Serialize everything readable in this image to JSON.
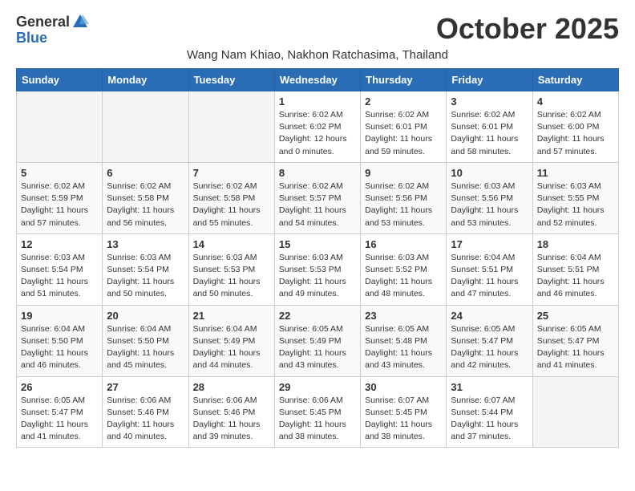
{
  "logo": {
    "general": "General",
    "blue": "Blue"
  },
  "title": "October 2025",
  "subtitle": "Wang Nam Khiao, Nakhon Ratchasima, Thailand",
  "weekdays": [
    "Sunday",
    "Monday",
    "Tuesday",
    "Wednesday",
    "Thursday",
    "Friday",
    "Saturday"
  ],
  "weeks": [
    [
      {
        "day": "",
        "info": ""
      },
      {
        "day": "",
        "info": ""
      },
      {
        "day": "",
        "info": ""
      },
      {
        "day": "1",
        "info": "Sunrise: 6:02 AM\nSunset: 6:02 PM\nDaylight: 12 hours\nand 0 minutes."
      },
      {
        "day": "2",
        "info": "Sunrise: 6:02 AM\nSunset: 6:01 PM\nDaylight: 11 hours\nand 59 minutes."
      },
      {
        "day": "3",
        "info": "Sunrise: 6:02 AM\nSunset: 6:01 PM\nDaylight: 11 hours\nand 58 minutes."
      },
      {
        "day": "4",
        "info": "Sunrise: 6:02 AM\nSunset: 6:00 PM\nDaylight: 11 hours\nand 57 minutes."
      }
    ],
    [
      {
        "day": "5",
        "info": "Sunrise: 6:02 AM\nSunset: 5:59 PM\nDaylight: 11 hours\nand 57 minutes."
      },
      {
        "day": "6",
        "info": "Sunrise: 6:02 AM\nSunset: 5:58 PM\nDaylight: 11 hours\nand 56 minutes."
      },
      {
        "day": "7",
        "info": "Sunrise: 6:02 AM\nSunset: 5:58 PM\nDaylight: 11 hours\nand 55 minutes."
      },
      {
        "day": "8",
        "info": "Sunrise: 6:02 AM\nSunset: 5:57 PM\nDaylight: 11 hours\nand 54 minutes."
      },
      {
        "day": "9",
        "info": "Sunrise: 6:02 AM\nSunset: 5:56 PM\nDaylight: 11 hours\nand 53 minutes."
      },
      {
        "day": "10",
        "info": "Sunrise: 6:03 AM\nSunset: 5:56 PM\nDaylight: 11 hours\nand 53 minutes."
      },
      {
        "day": "11",
        "info": "Sunrise: 6:03 AM\nSunset: 5:55 PM\nDaylight: 11 hours\nand 52 minutes."
      }
    ],
    [
      {
        "day": "12",
        "info": "Sunrise: 6:03 AM\nSunset: 5:54 PM\nDaylight: 11 hours\nand 51 minutes."
      },
      {
        "day": "13",
        "info": "Sunrise: 6:03 AM\nSunset: 5:54 PM\nDaylight: 11 hours\nand 50 minutes."
      },
      {
        "day": "14",
        "info": "Sunrise: 6:03 AM\nSunset: 5:53 PM\nDaylight: 11 hours\nand 50 minutes."
      },
      {
        "day": "15",
        "info": "Sunrise: 6:03 AM\nSunset: 5:53 PM\nDaylight: 11 hours\nand 49 minutes."
      },
      {
        "day": "16",
        "info": "Sunrise: 6:03 AM\nSunset: 5:52 PM\nDaylight: 11 hours\nand 48 minutes."
      },
      {
        "day": "17",
        "info": "Sunrise: 6:04 AM\nSunset: 5:51 PM\nDaylight: 11 hours\nand 47 minutes."
      },
      {
        "day": "18",
        "info": "Sunrise: 6:04 AM\nSunset: 5:51 PM\nDaylight: 11 hours\nand 46 minutes."
      }
    ],
    [
      {
        "day": "19",
        "info": "Sunrise: 6:04 AM\nSunset: 5:50 PM\nDaylight: 11 hours\nand 46 minutes."
      },
      {
        "day": "20",
        "info": "Sunrise: 6:04 AM\nSunset: 5:50 PM\nDaylight: 11 hours\nand 45 minutes."
      },
      {
        "day": "21",
        "info": "Sunrise: 6:04 AM\nSunset: 5:49 PM\nDaylight: 11 hours\nand 44 minutes."
      },
      {
        "day": "22",
        "info": "Sunrise: 6:05 AM\nSunset: 5:49 PM\nDaylight: 11 hours\nand 43 minutes."
      },
      {
        "day": "23",
        "info": "Sunrise: 6:05 AM\nSunset: 5:48 PM\nDaylight: 11 hours\nand 43 minutes."
      },
      {
        "day": "24",
        "info": "Sunrise: 6:05 AM\nSunset: 5:47 PM\nDaylight: 11 hours\nand 42 minutes."
      },
      {
        "day": "25",
        "info": "Sunrise: 6:05 AM\nSunset: 5:47 PM\nDaylight: 11 hours\nand 41 minutes."
      }
    ],
    [
      {
        "day": "26",
        "info": "Sunrise: 6:05 AM\nSunset: 5:47 PM\nDaylight: 11 hours\nand 41 minutes."
      },
      {
        "day": "27",
        "info": "Sunrise: 6:06 AM\nSunset: 5:46 PM\nDaylight: 11 hours\nand 40 minutes."
      },
      {
        "day": "28",
        "info": "Sunrise: 6:06 AM\nSunset: 5:46 PM\nDaylight: 11 hours\nand 39 minutes."
      },
      {
        "day": "29",
        "info": "Sunrise: 6:06 AM\nSunset: 5:45 PM\nDaylight: 11 hours\nand 38 minutes."
      },
      {
        "day": "30",
        "info": "Sunrise: 6:07 AM\nSunset: 5:45 PM\nDaylight: 11 hours\nand 38 minutes."
      },
      {
        "day": "31",
        "info": "Sunrise: 6:07 AM\nSunset: 5:44 PM\nDaylight: 11 hours\nand 37 minutes."
      },
      {
        "day": "",
        "info": ""
      }
    ]
  ]
}
